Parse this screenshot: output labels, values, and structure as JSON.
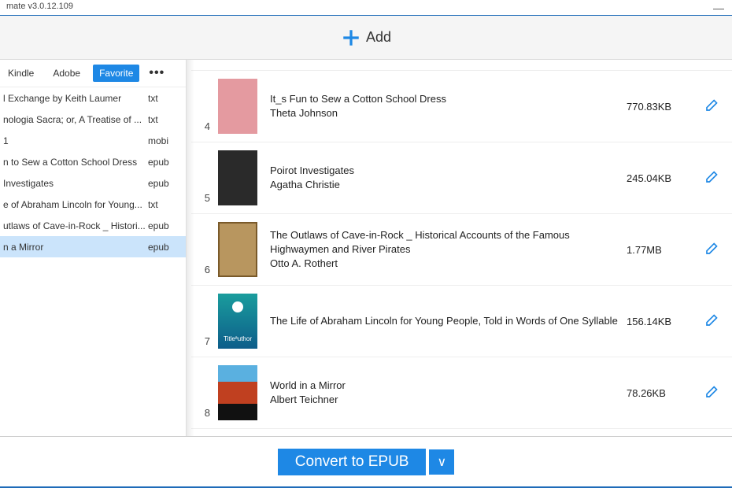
{
  "window": {
    "title": "mate v3.0.12.109",
    "minimize": "—"
  },
  "toolbar": {
    "add_label": "Add"
  },
  "tabs": {
    "items": [
      {
        "label": "Kindle"
      },
      {
        "label": "Adobe"
      },
      {
        "label": "Favorite"
      }
    ],
    "active": 2
  },
  "sidebar": {
    "items": [
      {
        "title": "l Exchange by Keith Laumer",
        "fmt": "txt"
      },
      {
        "title": "nologia Sacra; or, A Treatise of ...",
        "fmt": "txt"
      },
      {
        "title": "1",
        "fmt": "mobi"
      },
      {
        "title": "n to Sew a Cotton School Dress",
        "fmt": "epub"
      },
      {
        "title": "Investigates",
        "fmt": "epub"
      },
      {
        "title": "e of Abraham Lincoln for Young...",
        "fmt": "txt"
      },
      {
        "title": "utlaws of Cave-in-Rock _ Histori...",
        "fmt": "epub"
      },
      {
        "title": "n a Mirror",
        "fmt": "epub",
        "selected": true
      }
    ]
  },
  "books": [
    {
      "num": "4",
      "cover": "pink",
      "title": "It_s Fun to Sew a Cotton School Dress",
      "author": "Theta Johnson",
      "size": "770.83KB"
    },
    {
      "num": "5",
      "cover": "dark",
      "title": "Poirot Investigates",
      "author": "Agatha Christie",
      "size": "245.04KB"
    },
    {
      "num": "6",
      "cover": "tan",
      "title": "The Outlaws of Cave-in-Rock _ Historical Accounts of the Famous Highwaymen and River Pirates",
      "author": "Otto A. Rothert",
      "size": "1.77MB"
    },
    {
      "num": "7",
      "cover": "teal",
      "title": "The Life of Abraham Lincoln for Young People, Told in Words of One Syllable",
      "author": "",
      "size": "156.14KB"
    },
    {
      "num": "8",
      "cover": "scifi",
      "title": "World in a Mirror",
      "author": "Albert Teichner",
      "size": "78.26KB"
    }
  ],
  "footer": {
    "convert": "Convert to EPUB",
    "dd": "∨"
  }
}
